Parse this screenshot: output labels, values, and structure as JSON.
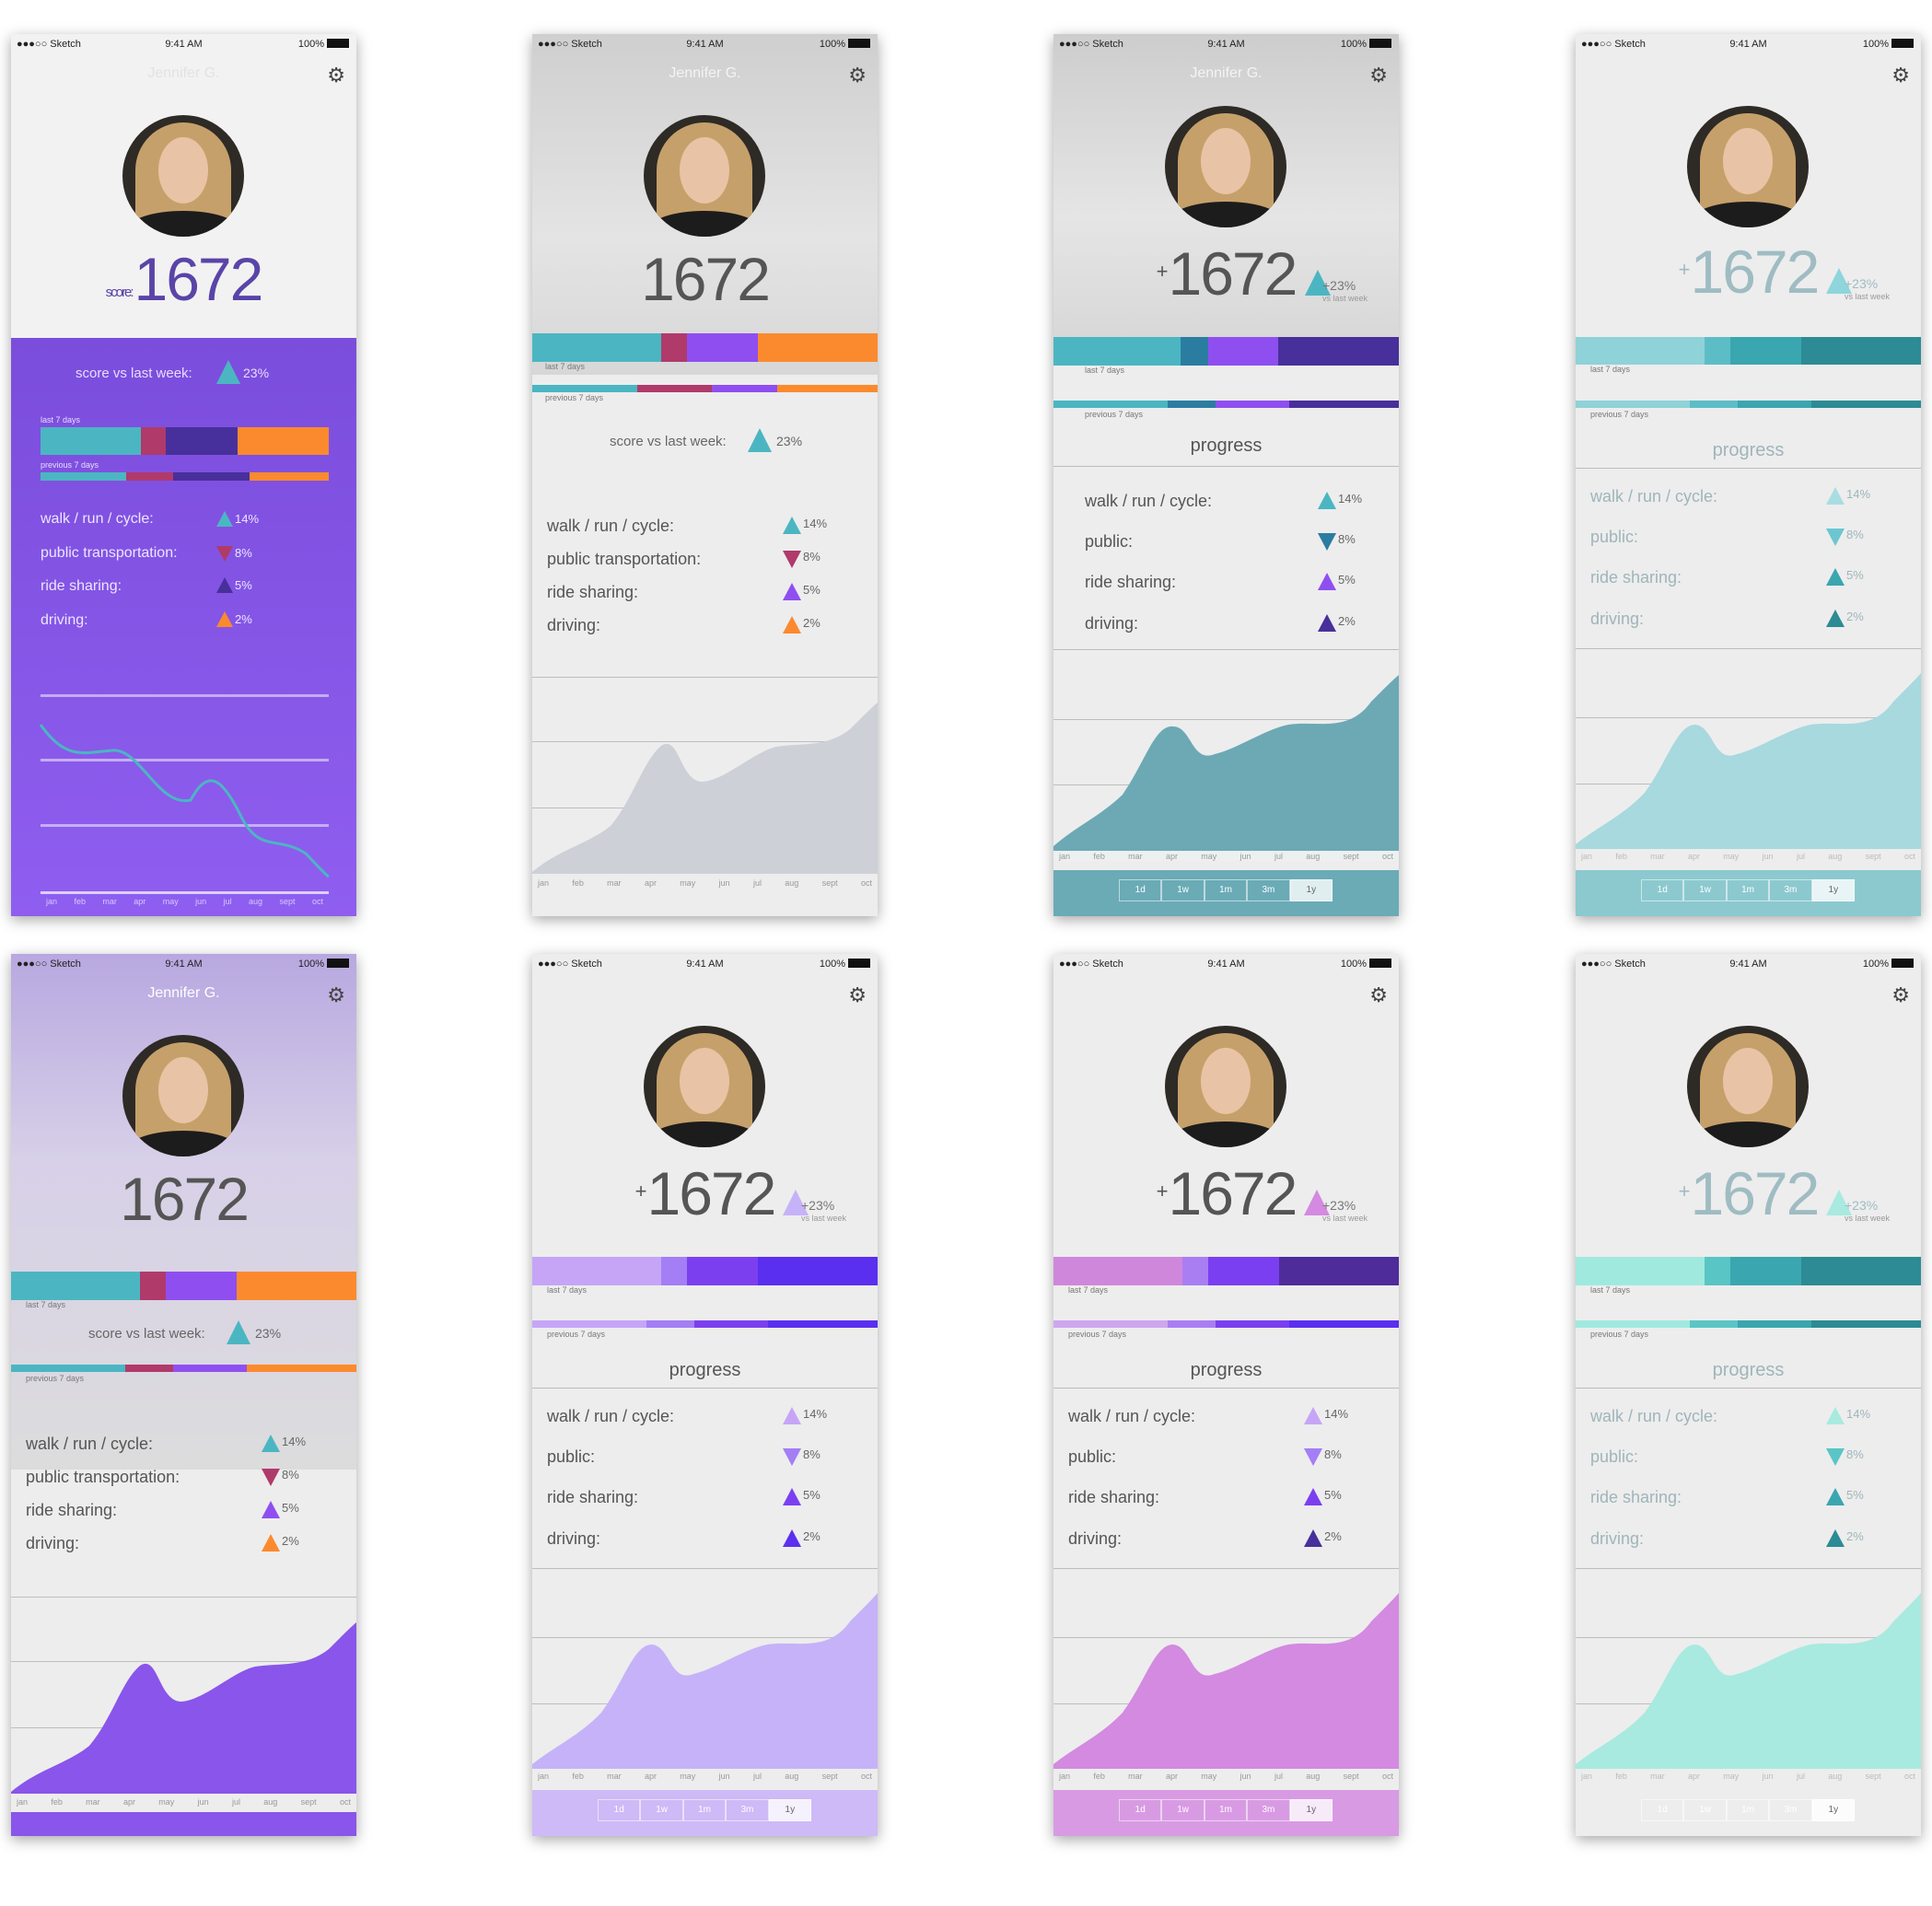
{
  "status": {
    "carrier": "●●●○○ Sketch",
    "time": "9:41 AM",
    "battery": "100%"
  },
  "user": {
    "name": "Jennifer G."
  },
  "score": {
    "value": "1672",
    "prefix": "+",
    "label": "score:",
    "delta": "+23%",
    "delta_caption": "vs last week"
  },
  "summary": {
    "vs_label": "score vs last week:",
    "vs_value": "23%"
  },
  "bars": {
    "last": "last 7 days",
    "previous": "previous 7 days"
  },
  "section_title": "progress",
  "categories": {
    "walk": "walk / run / cycle:",
    "public_long": "public transportation:",
    "public_short": "public:",
    "ride": "ride sharing:",
    "driving": "driving:"
  },
  "percents": {
    "walk": "14%",
    "public": "8%",
    "ride": "5%",
    "driving": "2%"
  },
  "months": [
    "jan",
    "feb",
    "mar",
    "apr",
    "may",
    "jun",
    "jul",
    "aug",
    "sept",
    "oct"
  ],
  "ranges": [
    "1d",
    "1w",
    "1m",
    "3m",
    "1y"
  ],
  "colors": {
    "purple_bg": "#8a55ea",
    "teal": "#4bb6c2",
    "magenta": "#b03a6a",
    "violet": "#8f4ff0",
    "orange": "#fb8a2e",
    "indigo": "#47309b",
    "lavender": "#c6b2f8",
    "orchid": "#d38ae0",
    "mint": "#a8eadf"
  }
}
